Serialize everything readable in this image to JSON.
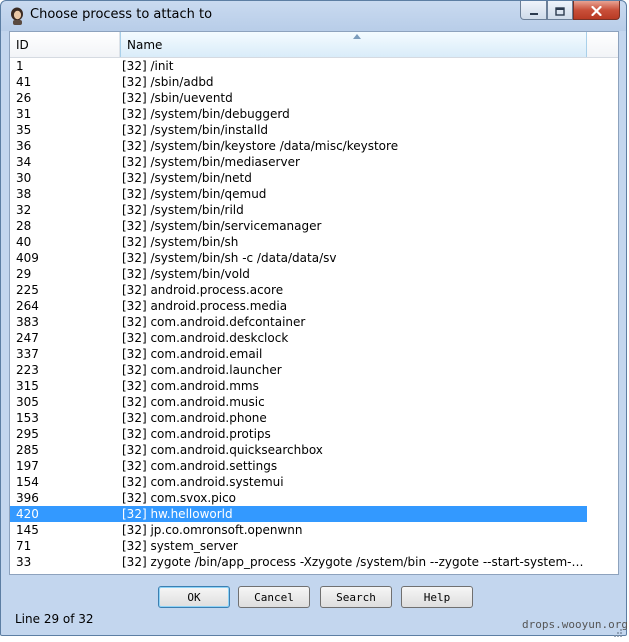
{
  "window": {
    "title": "Choose process to attach to"
  },
  "icons": {
    "app": "person-avatar-icon",
    "minimize": "minimize-icon",
    "maximize": "maximize-icon",
    "close": "close-icon",
    "sort": "sort-ascending-icon",
    "grip": "resize-grip-icon"
  },
  "colors": {
    "selection": "#3399ff",
    "close_button": "#c9503a",
    "frame": "#c3d6ee"
  },
  "columns": {
    "id": "ID",
    "name": "Name"
  },
  "rows": [
    {
      "id": "1",
      "name": "[32] /init"
    },
    {
      "id": "41",
      "name": "[32] /sbin/adbd"
    },
    {
      "id": "26",
      "name": "[32] /sbin/ueventd"
    },
    {
      "id": "31",
      "name": "[32] /system/bin/debuggerd"
    },
    {
      "id": "35",
      "name": "[32] /system/bin/installd"
    },
    {
      "id": "36",
      "name": "[32] /system/bin/keystore /data/misc/keystore"
    },
    {
      "id": "34",
      "name": "[32] /system/bin/mediaserver"
    },
    {
      "id": "30",
      "name": "[32] /system/bin/netd"
    },
    {
      "id": "38",
      "name": "[32] /system/bin/qemud"
    },
    {
      "id": "32",
      "name": "[32] /system/bin/rild"
    },
    {
      "id": "28",
      "name": "[32] /system/bin/servicemanager"
    },
    {
      "id": "40",
      "name": "[32] /system/bin/sh"
    },
    {
      "id": "409",
      "name": "[32] /system/bin/sh -c /data/data/sv"
    },
    {
      "id": "29",
      "name": "[32] /system/bin/vold"
    },
    {
      "id": "225",
      "name": "[32] android.process.acore"
    },
    {
      "id": "264",
      "name": "[32] android.process.media"
    },
    {
      "id": "383",
      "name": "[32] com.android.defcontainer"
    },
    {
      "id": "247",
      "name": "[32] com.android.deskclock"
    },
    {
      "id": "337",
      "name": "[32] com.android.email"
    },
    {
      "id": "223",
      "name": "[32] com.android.launcher"
    },
    {
      "id": "315",
      "name": "[32] com.android.mms"
    },
    {
      "id": "305",
      "name": "[32] com.android.music"
    },
    {
      "id": "153",
      "name": "[32] com.android.phone"
    },
    {
      "id": "295",
      "name": "[32] com.android.protips"
    },
    {
      "id": "285",
      "name": "[32] com.android.quicksearchbox"
    },
    {
      "id": "197",
      "name": "[32] com.android.settings"
    },
    {
      "id": "154",
      "name": "[32] com.android.systemui"
    },
    {
      "id": "396",
      "name": "[32] com.svox.pico"
    },
    {
      "id": "420",
      "name": "[32] hw.helloworld",
      "selected": true
    },
    {
      "id": "145",
      "name": "[32] jp.co.omronsoft.openwnn"
    },
    {
      "id": "71",
      "name": "[32] system_server"
    },
    {
      "id": "33",
      "name": "[32] zygote /bin/app_process -Xzygote /system/bin --zygote --start-system-s..."
    }
  ],
  "buttons": {
    "ok": "OK",
    "cancel": "Cancel",
    "search": "Search",
    "help": "Help"
  },
  "status": "Line 29 of 32",
  "watermark": "drops.wooyun.org"
}
